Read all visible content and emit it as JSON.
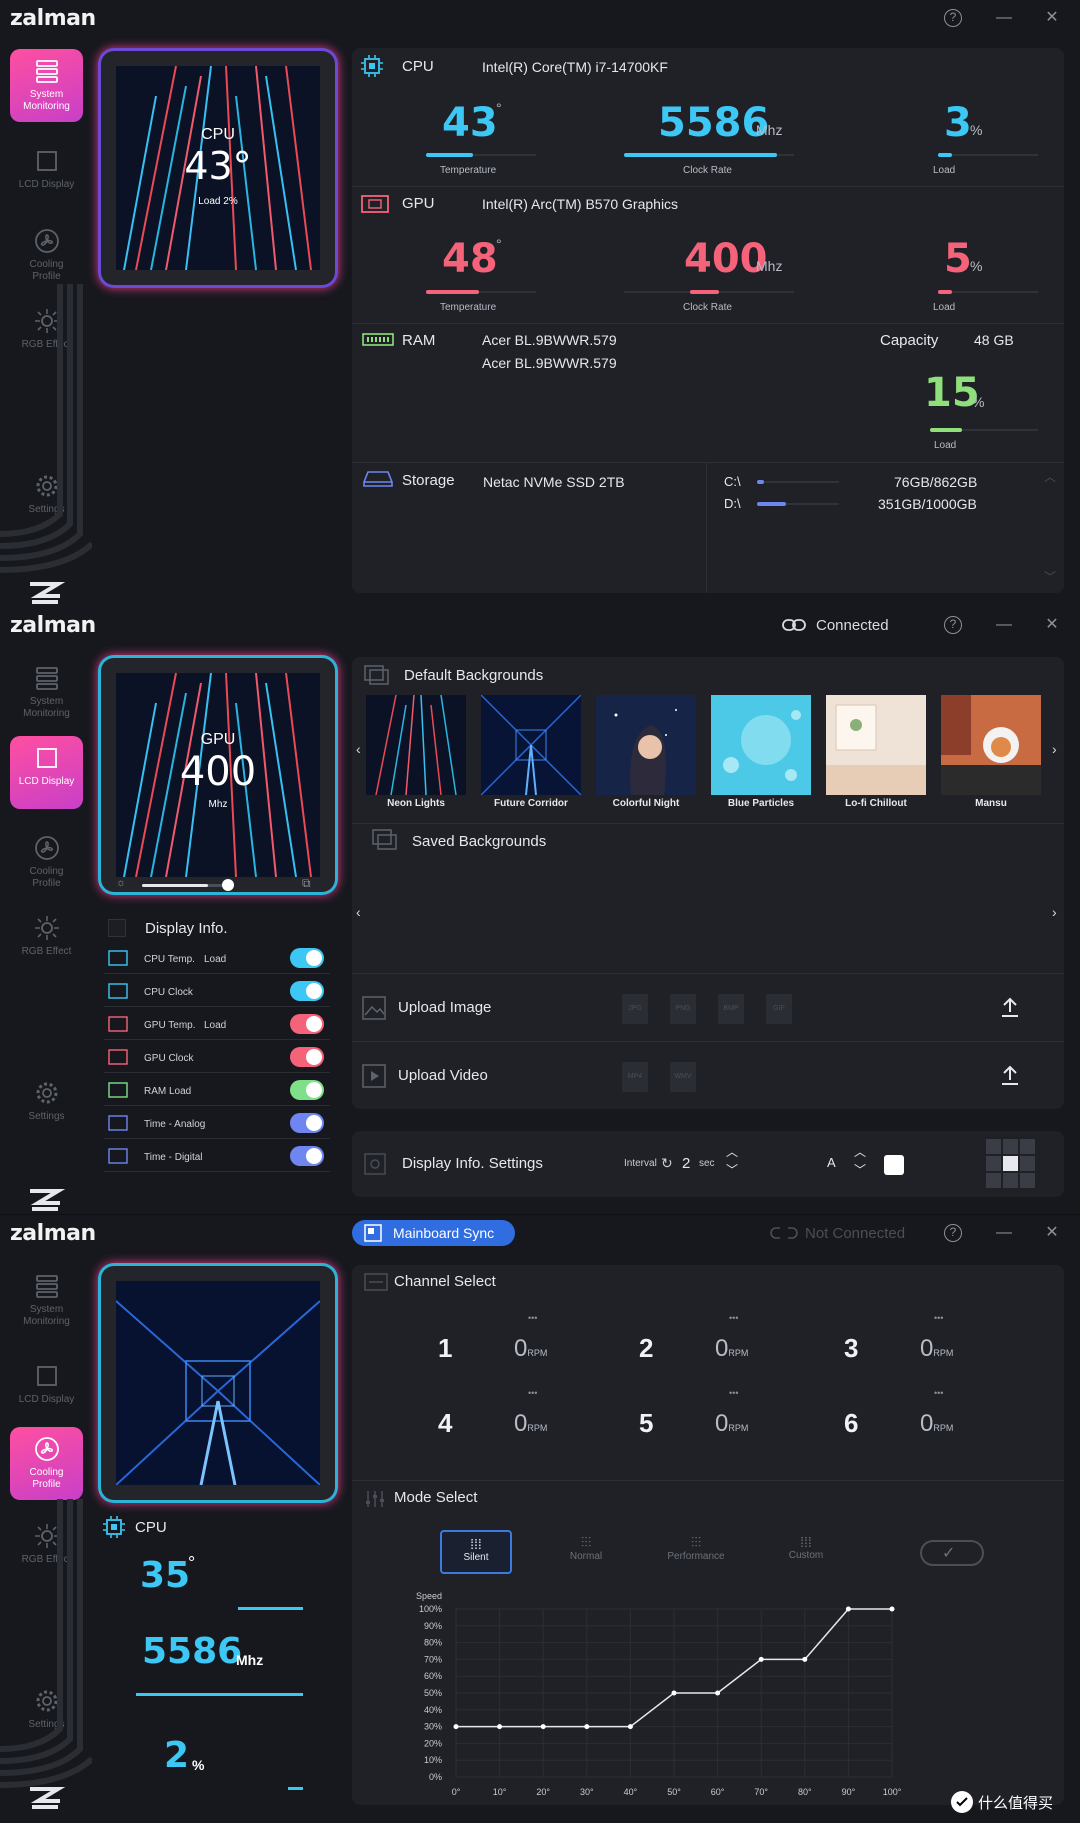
{
  "window1": {
    "logo": "zalman",
    "nav": [
      {
        "label1": "System",
        "label2": "Monitoring"
      },
      {
        "label1": "LCD Display",
        "label2": ""
      },
      {
        "label1": "Cooling",
        "label2": "Profile"
      },
      {
        "label1": "RGB Effect",
        "label2": ""
      },
      {
        "label1": "Settings",
        "label2": ""
      }
    ],
    "lcd": {
      "label": "CPU",
      "value": "43°",
      "sub": "Load  2%"
    },
    "cpu": {
      "title": "CPU",
      "name": "Intel(R) Core(TM) i7-14700KF",
      "temp": "43",
      "temp_unit": "°",
      "temp_label": "Temperature",
      "clock": "5586",
      "clock_unit": "Mhz",
      "clock_label": "Clock Rate",
      "load": "3",
      "load_unit": "%",
      "load_label": "Load"
    },
    "gpu": {
      "title": "GPU",
      "name": "Intel(R) Arc(TM) B570 Graphics",
      "temp": "48",
      "temp_unit": "°",
      "temp_label": "Temperature",
      "clock": "400",
      "clock_unit": "Mhz",
      "clock_label": "Clock Rate",
      "load": "5",
      "load_unit": "%",
      "load_label": "Load"
    },
    "ram": {
      "title": "RAM",
      "module1": "Acer BL.9BWWR.579",
      "module2": "Acer BL.9BWWR.579",
      "capacity_label": "Capacity",
      "capacity": "48 GB",
      "load": "15",
      "load_unit": "%",
      "load_label": "Load"
    },
    "storage": {
      "title": "Storage",
      "name": "Netac NVMe SSD 2TB",
      "drives": [
        {
          "letter": "C:\\",
          "usage": "76GB/862GB",
          "fraction": 0.09
        },
        {
          "letter": "D:\\",
          "usage": "351GB/1000GB",
          "fraction": 0.35
        }
      ]
    },
    "fill": {
      "cpu_temp": 0.43,
      "cpu_clock": 0.9,
      "cpu_load": 0.03,
      "gpu_temp": 0.48,
      "gpu_clock": 0.17,
      "gpu_load": 0.05,
      "ram_load": 0.15
    }
  },
  "window2": {
    "logo": "zalman",
    "connection": "Connected",
    "lcd": {
      "label": "GPU",
      "value": "400",
      "sub": "Mhz"
    },
    "default_bg_title": "Default Backgrounds",
    "backgrounds": [
      "Neon Lights",
      "Future Corridor",
      "Colorful Night",
      "Blue Particles",
      "Lo-fi Chillout",
      "Mansu"
    ],
    "saved_bg_title": "Saved Backgrounds",
    "upload_image": "Upload Image",
    "upload_video": "Upload Video",
    "image_formats": [
      "JPG",
      "PNG",
      "BMP",
      "GIF"
    ],
    "video_formats": [
      "MP4",
      "WMV"
    ],
    "display_info_title": "Display Info.",
    "display_items": [
      {
        "label": "CPU Temp.",
        "extra": "Load",
        "on": true,
        "color": "#3cc7f5"
      },
      {
        "label": "CPU Clock",
        "extra": "",
        "on": true,
        "color": "#3cc7f5"
      },
      {
        "label": "GPU Temp.",
        "extra": "Load",
        "on": true,
        "color": "#f5637a"
      },
      {
        "label": "GPU Clock",
        "extra": "",
        "on": true,
        "color": "#f5637a"
      },
      {
        "label": "RAM Load",
        "extra": "",
        "on": true,
        "color": "#7fe08a"
      },
      {
        "label": "Time - Analog",
        "extra": "",
        "on": true,
        "color": "#6f86f0"
      },
      {
        "label": "Time - Digital",
        "extra": "",
        "on": true,
        "color": "#6f86f0"
      }
    ],
    "settings_title": "Display Info. Settings",
    "interval_label": "Interval",
    "interval_value": "2",
    "interval_unit": "sec",
    "font_label": "A",
    "brightness": 0.72
  },
  "window3": {
    "logo": "zalman",
    "mainboard_sync": "Mainboard Sync",
    "connection": "Not Connected",
    "cpu_title": "CPU",
    "cpu_temp": "35",
    "cpu_temp_unit": "°",
    "cpu_clock": "5586",
    "cpu_clock_unit": "Mhz",
    "cpu_load": "2",
    "cpu_load_unit": "%",
    "channel_title": "Channel Select",
    "channels": [
      {
        "n": "1",
        "rpm": "0"
      },
      {
        "n": "2",
        "rpm": "0"
      },
      {
        "n": "3",
        "rpm": "0"
      },
      {
        "n": "4",
        "rpm": "0"
      },
      {
        "n": "5",
        "rpm": "0"
      },
      {
        "n": "6",
        "rpm": "0"
      }
    ],
    "rpm_unit": "RPM",
    "mode_title": "Mode Select",
    "modes": [
      "Silent",
      "Normal",
      "Performance",
      "Custom"
    ],
    "active_mode": "Silent"
  },
  "chart_data": {
    "type": "line",
    "ylabel": "Speed",
    "x": [
      0,
      10,
      20,
      30,
      40,
      50,
      60,
      70,
      80,
      90,
      100
    ],
    "x_tick_labels": [
      "0°",
      "10°",
      "20°",
      "30°",
      "40°",
      "50°",
      "60°",
      "70°",
      "80°",
      "90°",
      "100°"
    ],
    "y_tick_labels": [
      "100%",
      "90%",
      "80%",
      "70%",
      "60%",
      "50%",
      "40%",
      "30%",
      "20%",
      "10%",
      "0%"
    ],
    "values": [
      30,
      30,
      30,
      30,
      30,
      50,
      50,
      70,
      70,
      100,
      100
    ],
    "xlim": [
      0,
      100
    ],
    "ylim": [
      0,
      100
    ],
    "grid": true
  },
  "colors": {
    "cpu": "#3cc7f5",
    "gpu": "#f5637a",
    "ram": "#8fe07a",
    "accent": "#ff4fa0",
    "blue": "#3a7be0"
  }
}
